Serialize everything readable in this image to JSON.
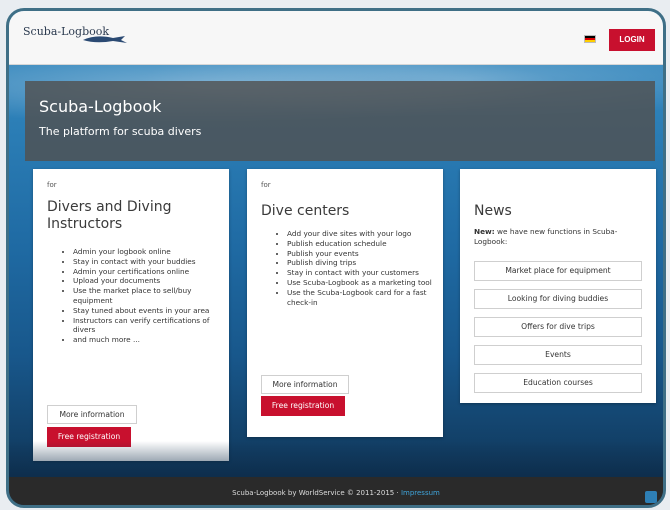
{
  "header": {
    "logo_text": "Scuba-Logbook",
    "language_flag": "de-flag-icon",
    "login_label": "LOGIN"
  },
  "hero": {
    "title": "Scuba-Logbook",
    "subtitle": "The platform for scuba divers"
  },
  "cards": {
    "divers": {
      "for_label": "for",
      "title": "Divers and Diving Instructors",
      "items": [
        "Admin your logbook online",
        "Stay in contact with your buddies",
        "Admin your certifications online",
        "Upload your documents",
        "Use the market place to sell/buy equipment",
        "Stay tuned about events in your area",
        "Instructors can verify certifications of divers",
        "and much more ..."
      ],
      "info_label": "More information",
      "register_label": "Free registration"
    },
    "centers": {
      "for_label": "for",
      "title": "Dive centers",
      "items": [
        "Add your dive sites with your logo",
        "Publish education schedule",
        "Publish your events",
        "Publish diving trips",
        "Stay in contact with your customers",
        "Use Scuba-Logbook as a marketing tool",
        "Use the Scuba-Logbook card for a fast check-in"
      ],
      "info_label": "More information",
      "register_label": "Free registration"
    },
    "news": {
      "title": "News",
      "intro_bold": "New:",
      "intro_text": " we have new functions in Scuba-Logbook:",
      "buttons": [
        "Market place for equipment",
        "Looking for diving buddies",
        "Offers for dive trips",
        "Events",
        "Education courses"
      ]
    }
  },
  "footer": {
    "text": "Scuba-Logbook by WorldService © 2011-2015 · ",
    "link": "Impressum"
  },
  "colors": {
    "accent": "#c8102e",
    "hero_bg": "#505050",
    "footer_bg": "#2a2a2a"
  }
}
